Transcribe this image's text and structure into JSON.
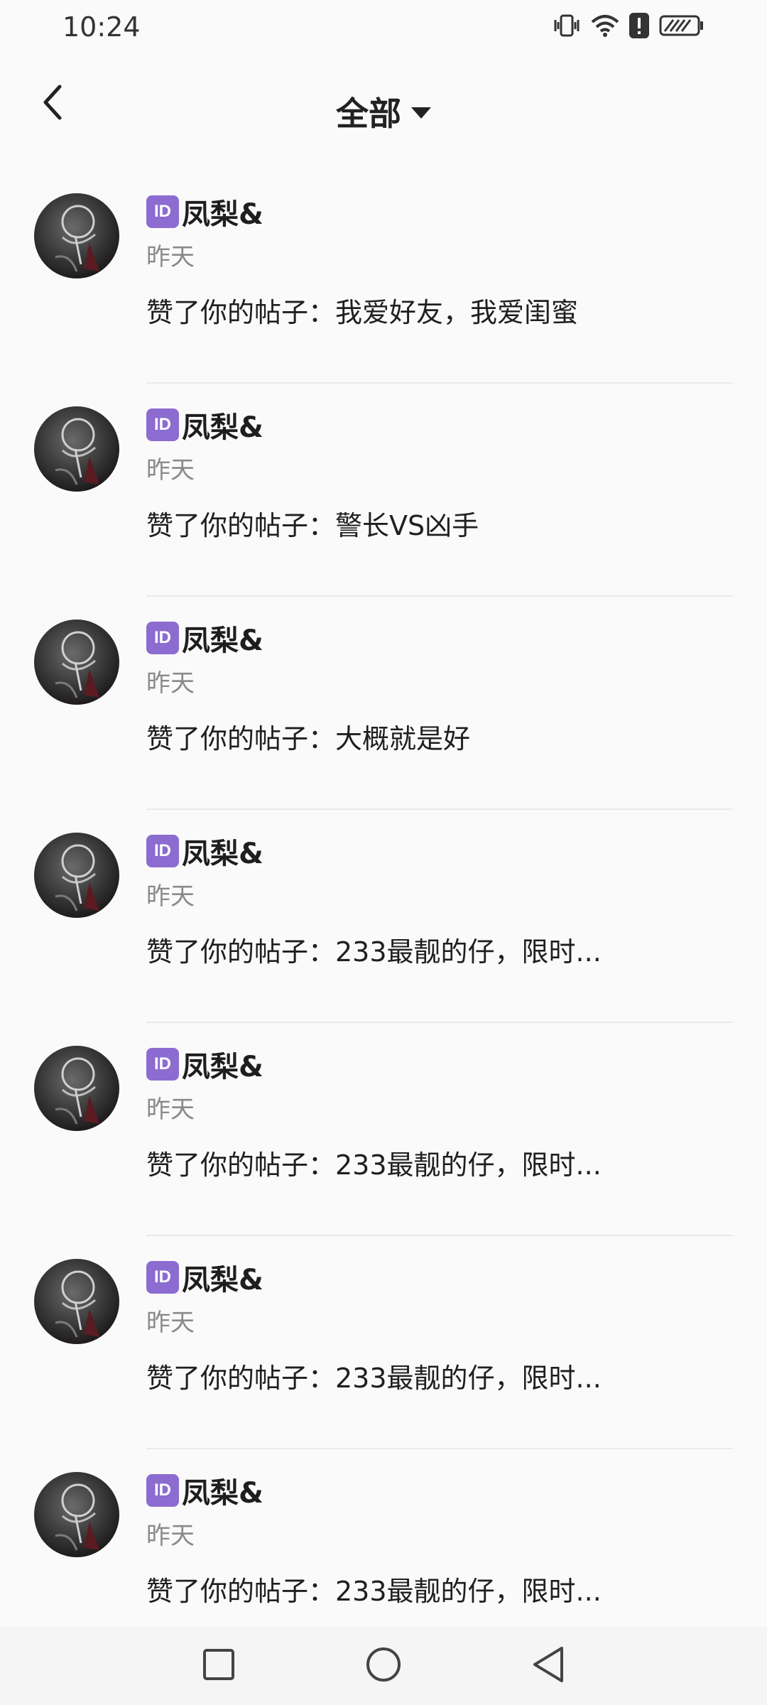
{
  "status_bar": {
    "time": "10:24",
    "icons": [
      "vibrate-icon",
      "wifi-icon",
      "alert-icon",
      "battery-saver-icon"
    ]
  },
  "header": {
    "back_icon": "chevron-left-icon",
    "title": "全部",
    "dropdown_icon": "caret-down-icon"
  },
  "notifications": [
    {
      "badge": "ID",
      "name": "凤梨&",
      "time": "昨天",
      "message": "赞了你的帖子：我爱好友，我爱闺蜜"
    },
    {
      "badge": "ID",
      "name": "凤梨&",
      "time": "昨天",
      "message": "赞了你的帖子：警长VS凶手"
    },
    {
      "badge": "ID",
      "name": "凤梨&",
      "time": "昨天",
      "message": "赞了你的帖子：大概就是好"
    },
    {
      "badge": "ID",
      "name": "凤梨&",
      "time": "昨天",
      "message": "赞了你的帖子：233最靓的仔，限时..."
    },
    {
      "badge": "ID",
      "name": "凤梨&",
      "time": "昨天",
      "message": "赞了你的帖子：233最靓的仔，限时..."
    },
    {
      "badge": "ID",
      "name": "凤梨&",
      "time": "昨天",
      "message": "赞了你的帖子：233最靓的仔，限时..."
    },
    {
      "badge": "ID",
      "name": "凤梨&",
      "time": "昨天",
      "message": "赞了你的帖子：233最靓的仔，限时..."
    }
  ],
  "nav_bar": {
    "buttons": [
      "recents-square-icon",
      "home-circle-icon",
      "back-triangle-icon"
    ]
  },
  "colors": {
    "background": "#fbfafb",
    "badge": "#8c6cd0",
    "secondary_text": "#8a8a8a"
  }
}
